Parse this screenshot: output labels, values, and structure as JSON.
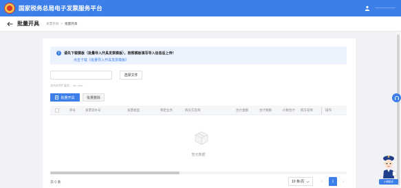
{
  "topbar": {
    "app_title": "国家税务总局电子发票服务平台",
    "user_name": "一一一一一一"
  },
  "header": {
    "page_title": "批量开具",
    "breadcrumb": [
      "发票开具",
      "批量开具"
    ]
  },
  "notice": {
    "text": "请先下载模板（批量导入开具发票模板），按照模板填写导入信息后上传！",
    "link": "点击下载《批量导入开具发票模板》"
  },
  "upload": {
    "file_placeholder": "",
    "select_button": "选择文件",
    "hint": "支持文件扩展名：.xls .xlsx"
  },
  "actions": {
    "batch_issue": "批量开具",
    "batch_delete": "批量删除"
  },
  "table": {
    "columns": [
      "序号",
      "发票流水号",
      "发票类型",
      "特定业务",
      "购买方名称",
      "合计金额",
      "合计税额",
      "价税合计",
      "购方名称",
      "操作"
    ],
    "rows": [],
    "empty_text": "暂无数据"
  },
  "pagination": {
    "total": "共 0 条",
    "page_size": "10 条/页",
    "current_page": "1"
  },
  "assistant": {
    "label": "小税助手"
  },
  "colors": {
    "primary": "#3d7fe8",
    "notice_bg": "#ecf3fe"
  }
}
